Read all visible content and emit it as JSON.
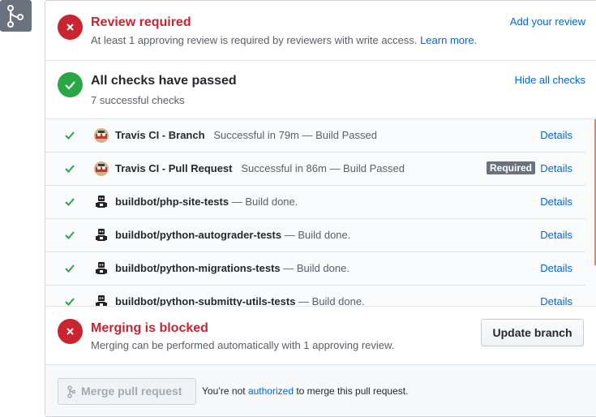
{
  "review": {
    "heading": "Review required",
    "subtext": "At least 1 approving review is required by reviewers with write access.",
    "learn_more": "Learn more.",
    "action": "Add your review"
  },
  "checks": {
    "heading": "All checks have passed",
    "subtext": "7 successful checks",
    "action": "Hide all checks",
    "items": [
      {
        "name": "Travis CI - Branch",
        "description": "Successful in 79m — Build Passed",
        "avatar": "travis-ci-icon",
        "required": "",
        "details": "Details"
      },
      {
        "name": "Travis CI - Pull Request",
        "description": "Successful in 86m — Build Passed",
        "avatar": "travis-ci-icon",
        "required": "Required",
        "details": "Details"
      },
      {
        "name": "buildbot/php-site-tests",
        "description": " — Build done.",
        "avatar": "buildbot-icon",
        "required": "",
        "details": "Details"
      },
      {
        "name": "buildbot/python-autograder-tests",
        "description": " — Build done.",
        "avatar": "buildbot-icon",
        "required": "",
        "details": "Details"
      },
      {
        "name": "buildbot/python-migrations-tests",
        "description": " — Build done.",
        "avatar": "buildbot-icon",
        "required": "",
        "details": "Details"
      },
      {
        "name": "buildbot/python-submitty-utils-tests",
        "description": " — Build done.",
        "avatar": "buildbot-icon",
        "required": "",
        "details": "Details"
      }
    ]
  },
  "merge_status": {
    "heading": "Merging is blocked",
    "subtext": "Merging can be performed automatically with 1 approving review.",
    "update_button": "Update branch"
  },
  "footer": {
    "merge_button": "Merge pull request",
    "text_prefix": "You’re not",
    "text_link": "authorized",
    "text_suffix": "to merge this pull request."
  },
  "colors": {
    "error": "#cb2431",
    "success": "#28a745",
    "link": "#0366d6",
    "scrollbar": "#f0824f"
  }
}
